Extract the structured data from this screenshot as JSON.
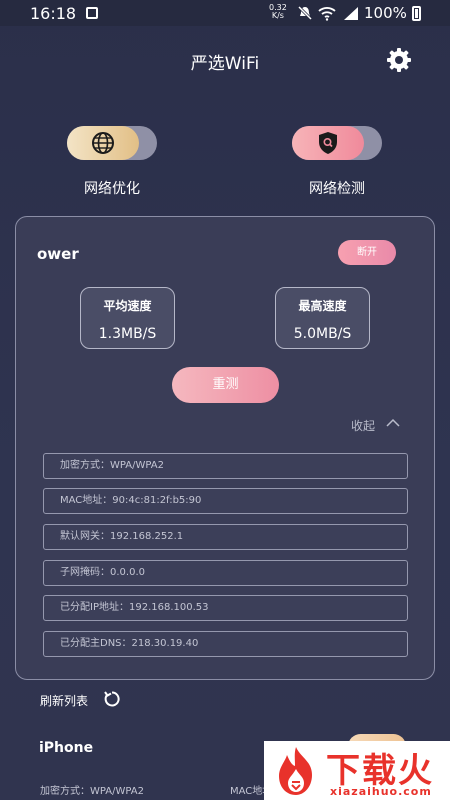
{
  "status_bar": {
    "time": "16:18",
    "net_speed_value": "0.32",
    "net_speed_unit": "K/s",
    "battery": "100%"
  },
  "header": {
    "title": "严选WiFi"
  },
  "tools": [
    {
      "label": "网络优化",
      "icon": "globe-icon"
    },
    {
      "label": "网络检测",
      "icon": "shield-search-icon"
    }
  ],
  "current_network": {
    "ssid": "ower",
    "disconnect_label": "断开",
    "avg_speed_label": "平均速度",
    "avg_speed_value": "1.3MB/S",
    "max_speed_label": "最高速度",
    "max_speed_value": "5.0MB/S",
    "retest_label": "重测",
    "collapse_label": "收起",
    "details": [
      "加密方式：WPA/WPA2",
      "MAC地址：90:4c:81:2f:b5:90",
      "默认网关：192.168.252.1",
      "子网掩码：0.0.0.0",
      "已分配IP地址：192.168.100.53",
      "已分配主DNS：218.30.19.40"
    ]
  },
  "refresh": {
    "label": "刷新列表"
  },
  "second_network": {
    "ssid": "iPhone",
    "encryption": "加密方式：WPA/WPA2",
    "mac_partial": "MAC地址"
  },
  "watermark": {
    "text": "下载火",
    "domain": "xiazaihuo.com"
  },
  "colors": {
    "background": "#2b2f4a",
    "accent_pink": "#ee8fa3",
    "accent_gold": "#e2bf86",
    "watermark_red": "#e8322b"
  }
}
